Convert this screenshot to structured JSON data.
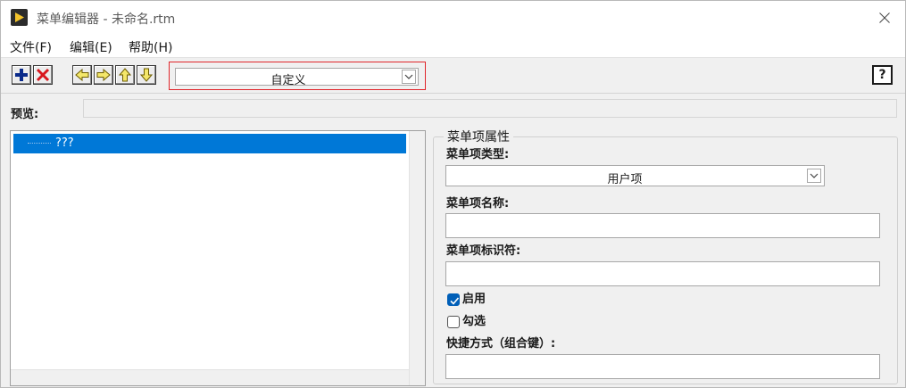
{
  "window": {
    "title": "菜单编辑器 - 未命名.rtm"
  },
  "menubar": {
    "items": [
      {
        "label": "文件(F)"
      },
      {
        "label": "编辑(E)"
      },
      {
        "label": "帮助(H)"
      }
    ]
  },
  "toolbar": {
    "buttons": [
      {
        "icon": "plus-icon"
      },
      {
        "icon": "delete-x-icon"
      },
      {
        "icon": "arrow-left-icon"
      },
      {
        "icon": "arrow-right-icon"
      },
      {
        "icon": "arrow-up-icon"
      },
      {
        "icon": "arrow-down-icon"
      }
    ],
    "menu_type_value": "自定义",
    "help_label": "?",
    "highlight_color": "#e0252b"
  },
  "preview": {
    "label": "预览:"
  },
  "tree": {
    "items": [
      {
        "label": "???",
        "selected": true
      }
    ],
    "selection_color": "#0078d7"
  },
  "properties": {
    "group_title": "菜单项属性",
    "type_label": "菜单项类型:",
    "type_value": "用户项",
    "name_label": "菜单项名称:",
    "name_value": "",
    "id_label": "菜单项标识符:",
    "id_value": "",
    "enabled_label": "启用",
    "enabled_checked": true,
    "checked_label": "勾选",
    "checked_checked": false,
    "shortcut_label": "快捷方式（组合键）:",
    "shortcut_value": ""
  }
}
